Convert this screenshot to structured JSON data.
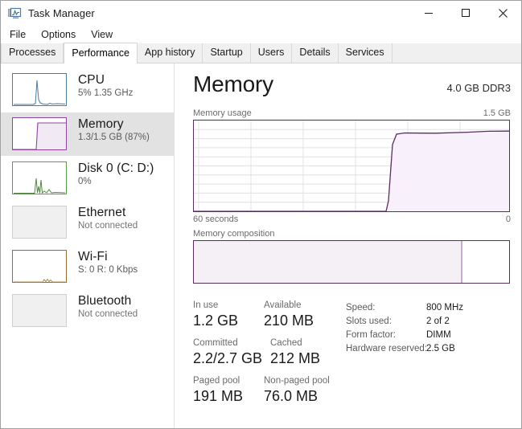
{
  "window": {
    "title": "Task Manager",
    "icon": "task-manager-icon",
    "controls": {
      "minimize": "─",
      "maximize": "□",
      "close": "✕"
    }
  },
  "menu": {
    "items": [
      "File",
      "Options",
      "View"
    ]
  },
  "tabs": [
    {
      "label": "Processes",
      "active": false
    },
    {
      "label": "Performance",
      "active": true
    },
    {
      "label": "App history",
      "active": false
    },
    {
      "label": "Startup",
      "active": false
    },
    {
      "label": "Users",
      "active": false
    },
    {
      "label": "Details",
      "active": false
    },
    {
      "label": "Services",
      "active": false
    }
  ],
  "sidebar": {
    "items": [
      {
        "title": "CPU",
        "sub": "5%  1.35 GHz",
        "selected": false,
        "graph": "spike",
        "color": "#4a7ba0"
      },
      {
        "title": "Memory",
        "sub": "1.3/1.5 GB (87%)",
        "selected": true,
        "graph": "block",
        "color": "#8c44a0"
      },
      {
        "title": "Disk 0 (C: D:)",
        "sub": "0%",
        "selected": false,
        "graph": "spikes",
        "color": "#4e8a3c"
      },
      {
        "title": "Ethernet",
        "sub": "Not connected",
        "selected": false,
        "graph": "none",
        "color": "#c0c0c0"
      },
      {
        "title": "Wi-Fi",
        "sub": "S: 0 R: 0 Kbps",
        "selected": false,
        "graph": "tiny",
        "color": "#9a6b2f"
      },
      {
        "title": "Bluetooth",
        "sub": "Not connected",
        "selected": false,
        "graph": "none",
        "color": "#c0c0c0"
      }
    ]
  },
  "main": {
    "title": "Memory",
    "spec": "4.0 GB DDR3",
    "usage_label": "Memory usage",
    "usage_max": "1.5 GB",
    "axis_left": "60 seconds",
    "axis_right": "0",
    "composition_label": "Memory composition",
    "accent_color": "#5b2c63"
  },
  "stats": {
    "rows": [
      [
        {
          "label": "In use",
          "value": "1.2 GB"
        },
        {
          "label": "Available",
          "value": "210 MB"
        }
      ],
      [
        {
          "label": "Committed",
          "value": "2.2/2.7 GB"
        },
        {
          "label": "Cached",
          "value": "212 MB"
        }
      ],
      [
        {
          "label": "Paged pool",
          "value": "191 MB"
        },
        {
          "label": "Non-paged pool",
          "value": "76.0 MB"
        }
      ]
    ],
    "info": [
      {
        "key": "Speed:",
        "value": "800 MHz"
      },
      {
        "key": "Slots used:",
        "value": "2 of 2"
      },
      {
        "key": "Form factor:",
        "value": "DIMM"
      },
      {
        "key": "Hardware reserved:",
        "value": "2.5 GB"
      }
    ]
  },
  "chart_data": {
    "type": "area",
    "title": "Memory usage",
    "xlabel": "60 seconds",
    "ylabel": "GB",
    "ylim": [
      0,
      1.5
    ],
    "xlim": [
      60,
      0
    ],
    "grid": true,
    "legend": false,
    "line_color": "#5b2c63",
    "fill_color": "#f7eef8",
    "x": [
      60,
      55,
      50,
      45,
      40,
      35,
      30,
      26,
      24,
      23,
      22,
      21,
      20,
      15,
      10,
      8,
      5,
      2,
      0
    ],
    "values": [
      0,
      0,
      0,
      0,
      0,
      0,
      0,
      0,
      0,
      0.05,
      0.55,
      1.15,
      1.28,
      1.28,
      1.27,
      1.27,
      1.28,
      1.3,
      1.3
    ],
    "annotations": [
      "60 seconds",
      "0",
      "1.5 GB"
    ]
  }
}
